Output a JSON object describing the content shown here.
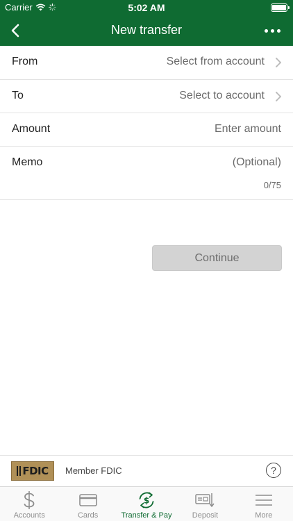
{
  "status_bar": {
    "carrier": "Carrier",
    "time": "5:02 AM"
  },
  "nav": {
    "title": "New transfer",
    "back_icon": "chevron-left-icon",
    "more_icon": "ellipsis-icon"
  },
  "form": {
    "from": {
      "label": "From",
      "placeholder": "Select from account"
    },
    "to": {
      "label": "To",
      "placeholder": "Select to account"
    },
    "amount": {
      "label": "Amount",
      "placeholder": "Enter amount"
    },
    "memo": {
      "label": "Memo",
      "placeholder": "(Optional)",
      "counter": "0/75"
    }
  },
  "continue_label": "Continue",
  "fdic": {
    "logo_text": "FDIC",
    "member_text": "Member FDIC",
    "help_label": "?"
  },
  "tabs": [
    {
      "label": "Accounts",
      "icon": "dollar-icon",
      "active": false
    },
    {
      "label": "Cards",
      "icon": "card-icon",
      "active": false
    },
    {
      "label": "Transfer & Pay",
      "icon": "transfer-pay-icon",
      "active": true
    },
    {
      "label": "Deposit",
      "icon": "check-deposit-icon",
      "active": false
    },
    {
      "label": "More",
      "icon": "menu-icon",
      "active": false
    }
  ],
  "colors": {
    "brand_green": "#0f6b32",
    "disabled_button": "#d3d3d3",
    "tab_inactive": "#8e8e8e",
    "fdic_gold": "#b09057"
  }
}
